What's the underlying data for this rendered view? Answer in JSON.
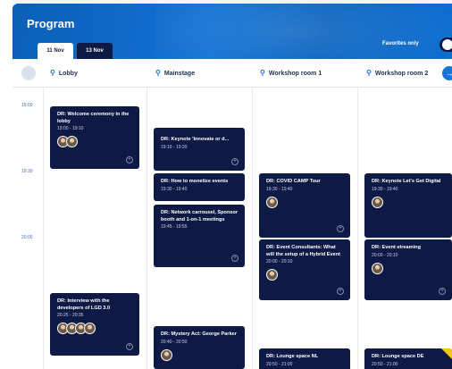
{
  "header": {
    "title": "Program",
    "tabs": [
      {
        "label": "11 Nov",
        "active": true
      },
      {
        "label": "13 Nov",
        "active": false
      }
    ],
    "favorites_label": "Favorites only"
  },
  "rooms": [
    "Lobby",
    "Mainstage",
    "Workshop room 1",
    "Workshop room 2"
  ],
  "times": [
    "19:00",
    "19:30",
    "20:00"
  ],
  "sessions": [
    {
      "title": "DR: Welcome ceremony in the lobby",
      "time": "19:00 - 19:10",
      "avatars": 2
    },
    {
      "title": "DR: Keynote 'Innovate or d...",
      "time": "19:10 - 19:20",
      "avatars": 0
    },
    {
      "title": "DR: How to monetize events",
      "time": "19:30 - 19:40",
      "avatars": 0
    },
    {
      "title": "DR: Network carrousel, Sponsor booth and 1-on-1 meetings",
      "time": "19:45 - 19:55",
      "avatars": 0
    },
    {
      "title": "DR: COVID CAMP Tour",
      "time": "19:30 - 19:40",
      "avatars": 1
    },
    {
      "title": "DR: Event Consultants: What will the setup of a Hybrid Event be like?",
      "time": "20:00 - 20:10",
      "avatars": 1
    },
    {
      "title": "DR: Keynote Let's Get Digital",
      "time": "19:30 - 19:40",
      "avatars": 1
    },
    {
      "title": "DR: Event streaming",
      "time": "20:00 - 20:10",
      "avatars": 1
    },
    {
      "title": "DR: Interview with the developers of LGD 3.0",
      "time": "20:25 - 20:35",
      "avatars": 4
    },
    {
      "title": "DR: Mystery Act: George Parker",
      "time": "20:40 - 20:50",
      "avatars": 1
    },
    {
      "title": "DR: Lounge space NL",
      "time": "20:50 - 21:00",
      "avatars": 0
    },
    {
      "title": "DR: Lounge space DE",
      "time": "20:50 - 21:00",
      "avatars": 0
    }
  ]
}
